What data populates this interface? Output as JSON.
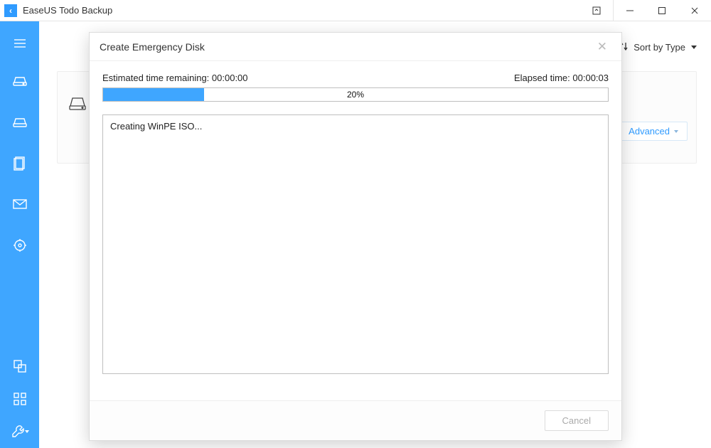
{
  "app": {
    "title": "EaseUS Todo Backup",
    "icon_glyph": "‹"
  },
  "window_controls": {
    "collapse_icon": "collapse-icon",
    "minimize_icon": "minimize-icon",
    "maximize_icon": "maximize-icon",
    "close_icon": "close-icon"
  },
  "sidebar": {
    "items": [
      {
        "name": "menu-icon"
      },
      {
        "name": "disk-backup-icon"
      },
      {
        "name": "system-backup-icon"
      },
      {
        "name": "file-backup-icon"
      },
      {
        "name": "mail-backup-icon"
      },
      {
        "name": "smart-backup-icon"
      }
    ],
    "bottom_items": [
      {
        "name": "clone-icon"
      },
      {
        "name": "tools-grid-icon"
      },
      {
        "name": "wrench-icon"
      }
    ]
  },
  "toolbar": {
    "sort_label": "Sort by Type"
  },
  "background_card": {
    "advanced_label": "Advanced"
  },
  "dialog": {
    "title": "Create Emergency Disk",
    "estimated_label": "Estimated time remaining:",
    "estimated_value": "00:00:00",
    "elapsed_label": "Elapsed time:",
    "elapsed_value": "00:00:03",
    "progress_percent": 20,
    "progress_text": "20%",
    "log_line_0": "Creating WinPE ISO...",
    "cancel_label": "Cancel"
  },
  "colors": {
    "accent": "#3fa6ff"
  }
}
